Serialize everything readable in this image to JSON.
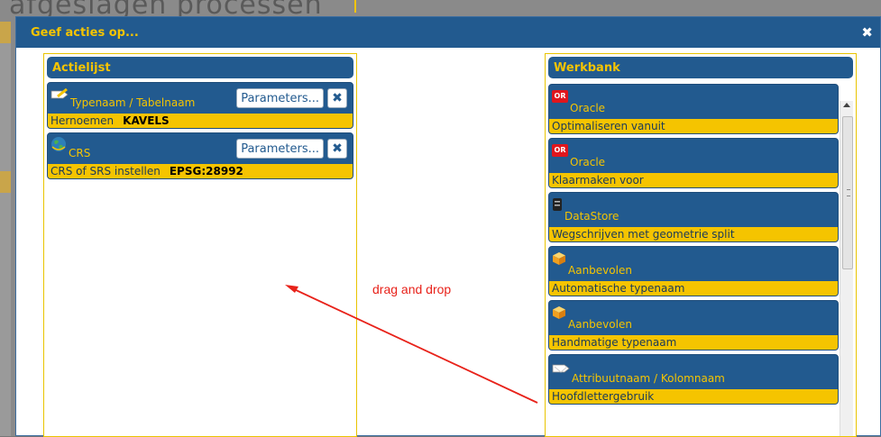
{
  "background": {
    "title": "afgeslagen processen"
  },
  "dialog": {
    "title": "Geef acties op...",
    "close_label": "✖"
  },
  "action_list": {
    "title": "Actielijst",
    "items": [
      {
        "name": "Typenaam / Tabelnaam",
        "button": "Parameters...",
        "label": "Hernoemen",
        "value": "KAVELS",
        "icon": "tag-icon"
      },
      {
        "name": "CRS",
        "button": "Parameters...",
        "label": "CRS of SRS instellen",
        "value": "EPSG:28992",
        "icon": "globe-icon"
      }
    ]
  },
  "workbench": {
    "title": "Werkbank",
    "items": [
      {
        "name": "Oracle",
        "label": "Optimaliseren vanuit",
        "icon": "oracle-icon"
      },
      {
        "name": "Oracle",
        "label": "Klaarmaken voor",
        "icon": "oracle-icon"
      },
      {
        "name": "DataStore",
        "label": "Wegschrijven met geometrie split",
        "icon": "datastore-icon"
      },
      {
        "name": "Aanbevolen",
        "label": "Automatische typenaam",
        "icon": "cube-icon"
      },
      {
        "name": "Aanbevolen",
        "label": "Handmatige typenaam",
        "icon": "cube-icon"
      },
      {
        "name": "Attribuutnaam / Kolomnaam",
        "label": "Hoofdlettergebruik",
        "icon": "tag-icon"
      }
    ]
  },
  "annotation": {
    "text": "drag and drop",
    "color": "#e8221a"
  },
  "colors": {
    "header": "#225a8f",
    "accent": "#f5c400"
  }
}
